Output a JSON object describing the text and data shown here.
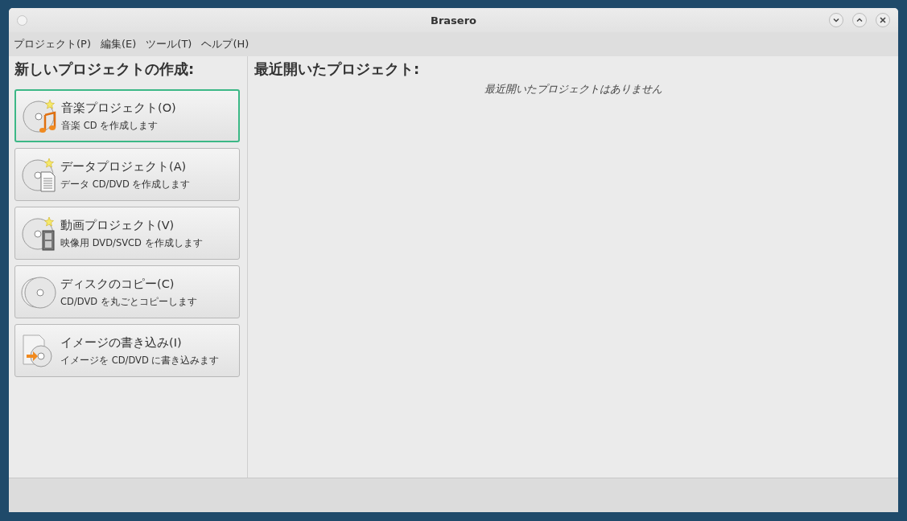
{
  "window": {
    "title": "Brasero"
  },
  "menu": [
    "プロジェクト(P)",
    "編集(E)",
    "ツール(T)",
    "ヘルプ(H)"
  ],
  "new_project": {
    "heading": "新しいプロジェクトの作成:",
    "buttons": [
      {
        "kind": "audio",
        "label": "音楽プロジェクト(O)",
        "description": "音楽 CD を作成します",
        "selected": true
      },
      {
        "kind": "data",
        "label": "データプロジェクト(A)",
        "description": "データ CD/DVD を作成します",
        "selected": false
      },
      {
        "kind": "video",
        "label": "動画プロジェクト(V)",
        "description": "映像用 DVD/SVCD を作成します",
        "selected": false
      },
      {
        "kind": "copy",
        "label": "ディスクのコピー(C)",
        "description": "CD/DVD を丸ごとコピーします",
        "selected": false
      },
      {
        "kind": "burn",
        "label": "イメージの書き込み(I)",
        "description": "イメージを CD/DVD に書き込みます",
        "selected": false
      }
    ]
  },
  "recent": {
    "heading": "最近開いたプロジェクト:",
    "empty_message": "最近開いたプロジェクトはありません"
  }
}
